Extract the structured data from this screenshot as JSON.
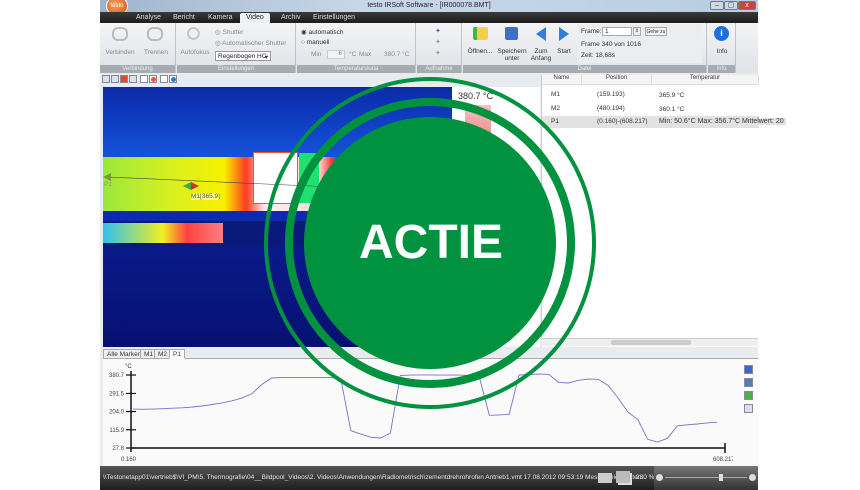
{
  "window": {
    "title": "testo IRSoft Software - [IR000078.BMT]",
    "logo": "testo",
    "min": "–",
    "max": "▢",
    "close": "x"
  },
  "tabs": [
    "Analyse",
    "Bericht",
    "Kamera",
    "Video",
    "Archiv",
    "Einstellungen"
  ],
  "active_tab": "Video",
  "ribbon": {
    "verbindung": {
      "label": "Verbindung",
      "verbinden": "Verbinden",
      "trennen": "Trennen"
    },
    "einstellungen": {
      "label": "Einstellungen",
      "autofokus": "Autofokus",
      "shutter": "Shutter",
      "auto_shutter": "Automatischer Shutter",
      "palette": "Regenbogen HC"
    },
    "temperaturskala": {
      "label": "Temperaturskala",
      "automatisch": "automatisch",
      "manuell": "manuell",
      "min_label": "Min",
      "min_value": "6",
      "unit": "°C",
      "max_label": "Max",
      "max_value": "380.7 °C"
    },
    "aufnahme": {
      "label": "Aufnahme"
    },
    "datei": {
      "label": "Datei",
      "oeffnen": "Öffnen...",
      "speichern": "Speichern unter",
      "zum_anfang": "Zum Anfang",
      "start": "Start",
      "frame_label": "Frame:",
      "frame_value": "1",
      "gehe_zu": "Gehe zu",
      "frame_info": "Frame 340 von 1016",
      "zeit": "Zeit: 18,68s"
    },
    "info": {
      "label": "Info",
      "button": "Info"
    }
  },
  "thermal": {
    "scale_max": "380.7 °C",
    "marker_p1": "P1",
    "marker_m1": "M1[365.9]"
  },
  "markers_table": {
    "columns": [
      "Name",
      "Position",
      "Temperatur"
    ],
    "rows": [
      {
        "name": "M1",
        "position": "(159.193)",
        "temp": "365.9 °C"
      },
      {
        "name": "M2",
        "position": "(480.194)",
        "temp": "360.1 °C"
      },
      {
        "name": "P1",
        "position": "(0.160)-(608.217)",
        "temp": "Min: 50.6°C Max: 356.7°C Mittelwert: 20"
      }
    ],
    "selected": "P1"
  },
  "chart_tabs": [
    "Alle Marker",
    "M1",
    "M2",
    "P1"
  ],
  "active_chart_tab": "P1",
  "chart_data": {
    "type": "line",
    "ylabel": "°C",
    "yticks": [
      "380.7",
      "291.5",
      "204.0",
      "115.9",
      "27.8"
    ],
    "ylim": [
      27.8,
      380.7
    ],
    "xtick_labels": [
      "0.160",
      "608.217"
    ],
    "grid": false,
    "color": "#7b72c8",
    "series": [
      {
        "values": [
          216,
          215,
          216,
          218,
          220,
          222,
          226,
          231,
          238,
          246,
          256,
          269,
          290,
          335,
          366,
          368,
          369,
          369,
          368,
          368,
          368,
          360,
          112,
          95,
          80,
          76,
          100,
          378,
          380,
          381,
          381,
          380,
          380,
          380,
          379,
          370,
          186,
          188,
          190,
          380,
          383,
          385,
          384,
          345,
          342,
          355,
          361,
          360,
          330,
          270,
          202,
          165,
          70,
          57,
          75,
          135,
          140,
          144,
          149,
          152
        ]
      }
    ]
  },
  "status": {
    "path": "\\\\Testonetapp01\\vertrieb$\\VI_PM\\5. Thermografie\\04__Bildpool_Videos\\2. Videos\\Anwendungen\\Radiometrisch\\zementdrehrohrofen Antrieb1.vmt  17.08.2012  09:53:19  Messbereichsdaten...",
    "zoom": "230 %"
  },
  "overlay": {
    "text": "ACTIE",
    "color": "#00923f"
  }
}
